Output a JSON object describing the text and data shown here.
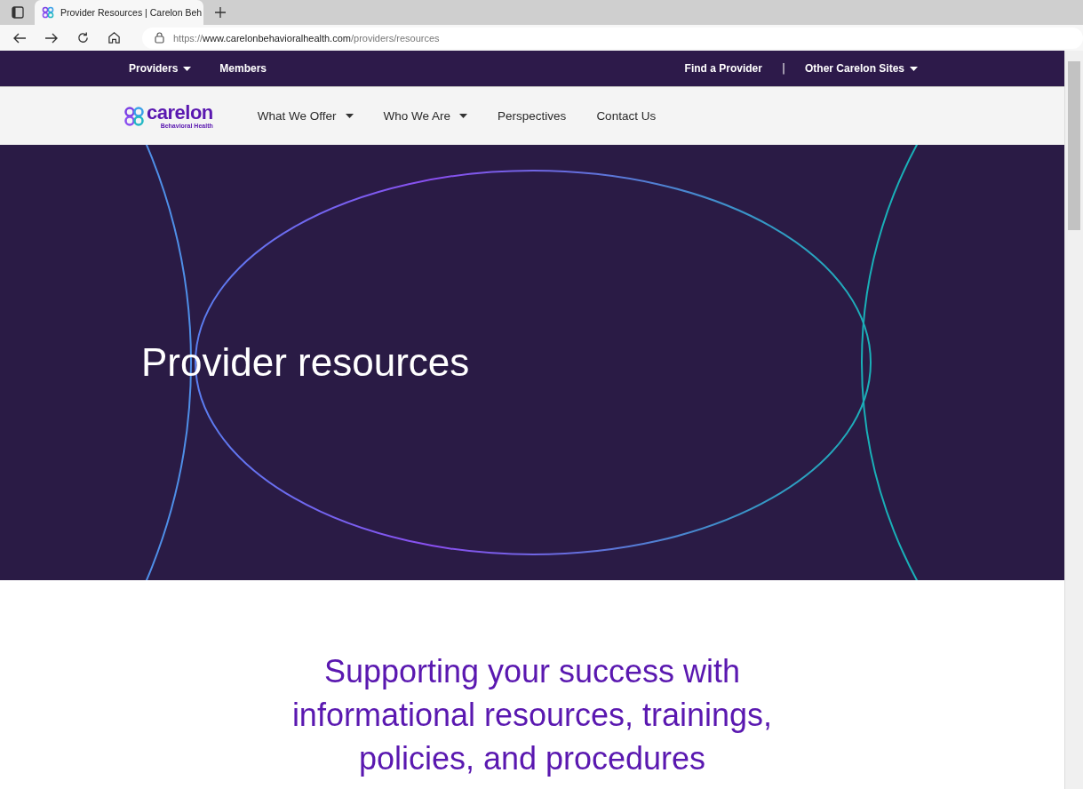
{
  "browser": {
    "tab": {
      "title": "Provider Resources | Carelon Beh",
      "selected": true
    },
    "url": {
      "scheme": "https://",
      "host": "www.carelonbehavioralhealth.com",
      "path": "/providers/resources"
    }
  },
  "utility_nav": {
    "left": [
      {
        "label": "Providers",
        "has_dropdown": true
      },
      {
        "label": "Members",
        "has_dropdown": false
      }
    ],
    "right": [
      {
        "label": "Find a Provider",
        "has_dropdown": false
      },
      {
        "label": "Other Carelon Sites",
        "has_dropdown": true
      }
    ],
    "separator": "|"
  },
  "logo": {
    "wordmark": "carelon",
    "tagline": "Behavioral Health"
  },
  "main_nav": [
    {
      "label": "What We Offer",
      "has_dropdown": true
    },
    {
      "label": "Who We Are",
      "has_dropdown": true
    },
    {
      "label": "Perspectives",
      "has_dropdown": false
    },
    {
      "label": "Contact Us",
      "has_dropdown": false
    }
  ],
  "hero": {
    "title": "Provider resources"
  },
  "intro": {
    "heading": "Supporting your success with informational resources, trainings, policies, and procedures"
  }
}
